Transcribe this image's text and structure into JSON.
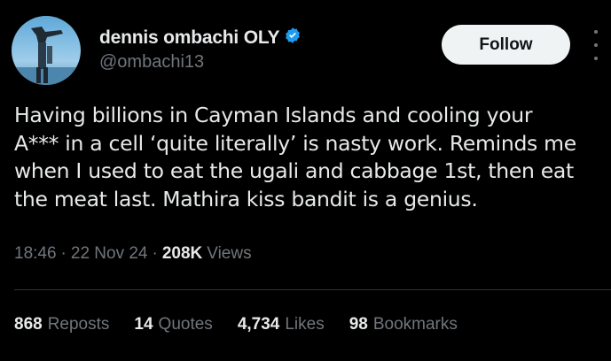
{
  "user": {
    "display_name": "dennis ombachi OLY",
    "handle": "@ombachi13",
    "verified_icon": "verified-badge-icon"
  },
  "actions": {
    "follow_label": "Follow",
    "more_icon": "more-options-icon"
  },
  "tweet": {
    "text": "Having billions in Cayman Islands and cooling your\nA*** in a cell ‘quite literally’ is nasty work. Reminds me\nwhen I used to eat the ugali and cabbage 1st, then eat\nthe meat last. Mathira kiss bandit is a genius."
  },
  "meta": {
    "time": "18:46",
    "separator": "·",
    "date": "22 Nov 24",
    "views_count": "208K",
    "views_label": "Views"
  },
  "stats": {
    "reposts_count": "868",
    "reposts_label": "Reposts",
    "quotes_count": "14",
    "quotes_label": "Quotes",
    "likes_count": "4,734",
    "likes_label": "Likes",
    "bookmarks_count": "98",
    "bookmarks_label": "Bookmarks"
  },
  "colors": {
    "background": "#000000",
    "text_primary": "#e7e9ea",
    "text_secondary": "#71767b",
    "verified_blue": "#1d9bf0",
    "follow_bg": "#eff3f4",
    "divider": "#2f3336"
  }
}
